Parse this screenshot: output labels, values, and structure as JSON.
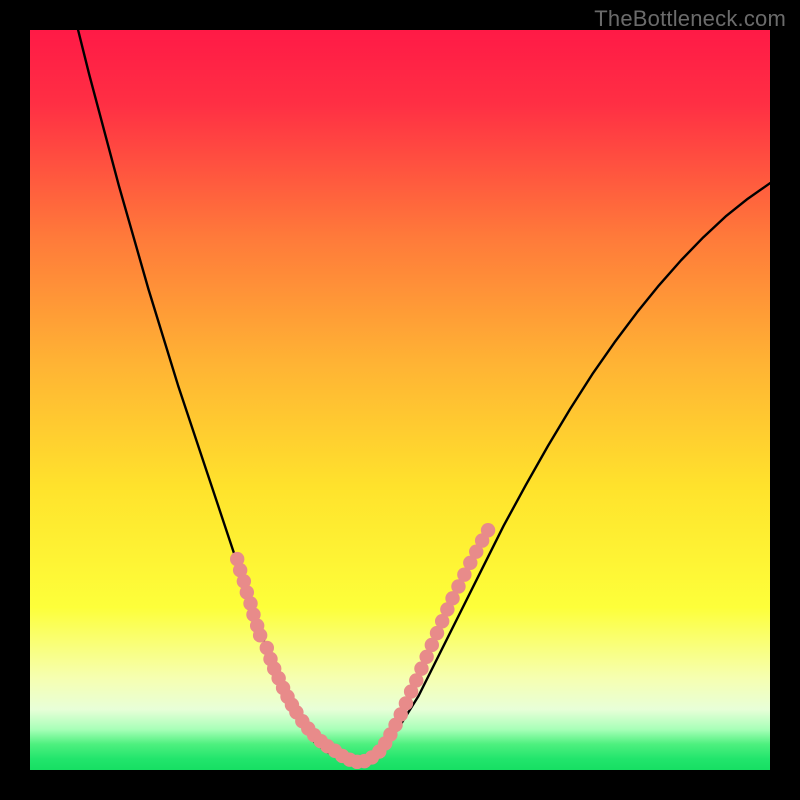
{
  "watermark": "TheBottleneck.com",
  "colors": {
    "frame": "#000000",
    "curve": "#000000",
    "dots": "#e88b8a",
    "green_band": "#2ee56f",
    "gradient_stops": [
      {
        "offset": 0.0,
        "color": "#ff1a46"
      },
      {
        "offset": 0.1,
        "color": "#ff2f44"
      },
      {
        "offset": 0.28,
        "color": "#ff7a3a"
      },
      {
        "offset": 0.45,
        "color": "#ffb334"
      },
      {
        "offset": 0.62,
        "color": "#ffe32c"
      },
      {
        "offset": 0.78,
        "color": "#fdff3a"
      },
      {
        "offset": 0.875,
        "color": "#f6ffb0"
      },
      {
        "offset": 0.918,
        "color": "#e8ffd8"
      },
      {
        "offset": 0.945,
        "color": "#a8ffb8"
      },
      {
        "offset": 0.965,
        "color": "#4ef07f"
      },
      {
        "offset": 0.985,
        "color": "#22e56c"
      },
      {
        "offset": 1.0,
        "color": "#17df63"
      }
    ]
  },
  "chart_data": {
    "type": "line",
    "title": "",
    "xlabel": "",
    "ylabel": "",
    "xlim": [
      0,
      100
    ],
    "ylim": [
      0,
      100
    ],
    "grid": false,
    "series": [
      {
        "name": "bottleneck-curve",
        "x": [
          6,
          8,
          10,
          12,
          14,
          16,
          18,
          20,
          22,
          24,
          25.5,
          27,
          28.5,
          30,
          31.3,
          32.5,
          33.7,
          34.8,
          36,
          37.2,
          38.5,
          40,
          42,
          44,
          46,
          48,
          50,
          52.5,
          55,
          58,
          61,
          64,
          67,
          70,
          73,
          76,
          79,
          82,
          85,
          88,
          91,
          94,
          97,
          100
        ],
        "y": [
          102,
          94,
          86.5,
          79,
          72,
          65,
          58.5,
          52,
          46,
          40,
          35.5,
          31,
          26.5,
          22,
          18.3,
          15,
          12,
          9.4,
          7.1,
          5.2,
          3.7,
          2.5,
          1.5,
          1.0,
          1.5,
          3.0,
          6.0,
          10.0,
          15.0,
          21.0,
          27.0,
          33.0,
          38.5,
          43.8,
          48.8,
          53.5,
          57.8,
          61.8,
          65.5,
          68.9,
          72.0,
          74.8,
          77.2,
          79.3
        ]
      }
    ],
    "dot_clusters": [
      {
        "name": "left-upper-segment",
        "points": [
          [
            28.0,
            28.5
          ],
          [
            28.4,
            27.0
          ],
          [
            28.9,
            25.5
          ],
          [
            29.3,
            24.0
          ],
          [
            29.8,
            22.5
          ],
          [
            30.2,
            21.0
          ],
          [
            30.7,
            19.5
          ],
          [
            31.1,
            18.2
          ]
        ]
      },
      {
        "name": "left-lower-segment",
        "points": [
          [
            32.0,
            16.5
          ],
          [
            32.5,
            15.0
          ],
          [
            33.0,
            13.7
          ],
          [
            33.6,
            12.4
          ],
          [
            34.2,
            11.1
          ],
          [
            34.8,
            9.9
          ],
          [
            35.4,
            8.8
          ],
          [
            36.0,
            7.8
          ]
        ]
      },
      {
        "name": "valley-left",
        "points": [
          [
            36.8,
            6.6
          ],
          [
            37.6,
            5.6
          ],
          [
            38.4,
            4.7
          ],
          [
            39.3,
            3.9
          ],
          [
            40.2,
            3.2
          ],
          [
            41.2,
            2.6
          ]
        ]
      },
      {
        "name": "valley-floor",
        "points": [
          [
            42.2,
            1.9
          ],
          [
            43.2,
            1.4
          ],
          [
            44.2,
            1.1
          ],
          [
            45.2,
            1.2
          ],
          [
            46.2,
            1.7
          ],
          [
            47.2,
            2.5
          ]
        ]
      },
      {
        "name": "valley-right",
        "points": [
          [
            48.0,
            3.6
          ],
          [
            48.7,
            4.8
          ],
          [
            49.4,
            6.1
          ],
          [
            50.1,
            7.5
          ],
          [
            50.8,
            9.0
          ],
          [
            51.5,
            10.6
          ]
        ]
      },
      {
        "name": "right-mid-segment",
        "points": [
          [
            52.2,
            12.1
          ],
          [
            52.9,
            13.7
          ],
          [
            53.6,
            15.3
          ],
          [
            54.3,
            16.9
          ],
          [
            55.0,
            18.5
          ],
          [
            55.7,
            20.1
          ],
          [
            56.4,
            21.7
          ],
          [
            57.1,
            23.2
          ]
        ]
      },
      {
        "name": "right-upper-segment",
        "points": [
          [
            57.9,
            24.8
          ],
          [
            58.7,
            26.4
          ],
          [
            59.5,
            28.0
          ],
          [
            60.3,
            29.5
          ],
          [
            61.1,
            31.0
          ],
          [
            61.9,
            32.4
          ]
        ]
      }
    ]
  }
}
